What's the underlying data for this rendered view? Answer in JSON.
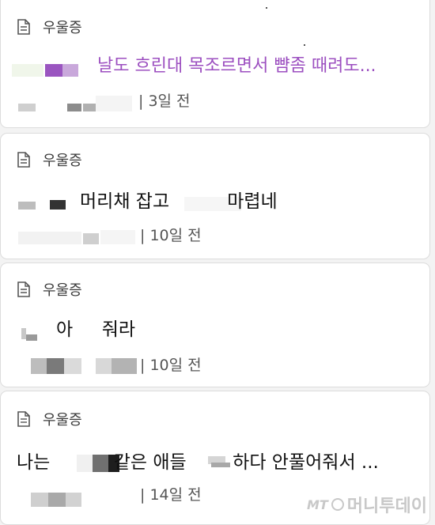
{
  "posts": [
    {
      "category": "우울증",
      "title": "날도 흐린대 목조르면서 뺨좀 때려도...",
      "meta": "| 3일 전",
      "title_color": "#9c4fc0"
    },
    {
      "category": "우울증",
      "title": "머리채 잡고          마렵네",
      "meta": "| 10일 전"
    },
    {
      "category": "우울증",
      "title": "아     줘라",
      "meta": "| 10일 전"
    },
    {
      "category": "우울증",
      "title": "나는           같은 애들        하다 안풀어줘서 ...",
      "meta": "| 14일 전"
    }
  ],
  "icons": {
    "category": "document-icon"
  },
  "watermark": {
    "mt": "MT",
    "text": "머니투데이"
  }
}
